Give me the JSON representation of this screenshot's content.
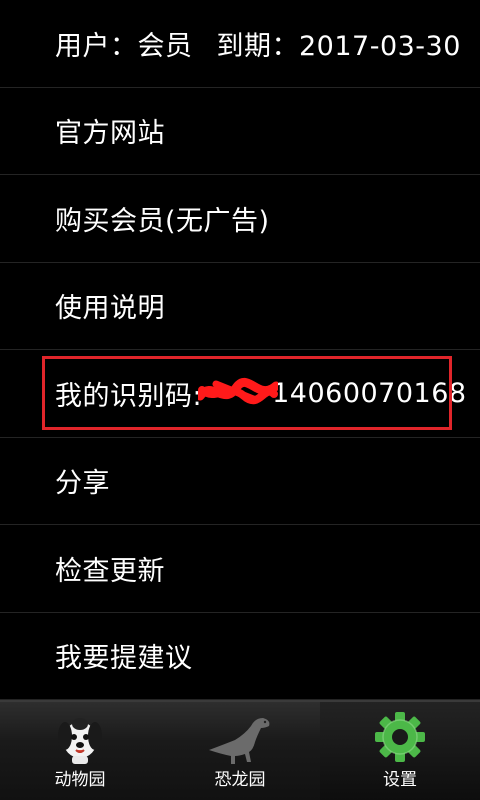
{
  "header": {
    "user_label": "用户：会员",
    "expiry_label": "到期：2017-03-30"
  },
  "menu": {
    "items": [
      {
        "label": "官方网站"
      },
      {
        "label": "购买会员(无广告)"
      },
      {
        "label": "使用说明"
      },
      {
        "label_prefix": "我的识别码:",
        "label_visible_suffix": "14060070168",
        "highlighted": true
      },
      {
        "label": "分享"
      },
      {
        "label": "检查更新"
      },
      {
        "label": "我要提建议"
      }
    ]
  },
  "tabs": [
    {
      "label": "动物园",
      "icon": "puppy-icon",
      "active": false
    },
    {
      "label": "恐龙园",
      "icon": "dinosaur-icon",
      "active": false
    },
    {
      "label": "设置",
      "icon": "gear-icon",
      "active": true
    }
  ],
  "colors": {
    "background": "#000000",
    "highlight_border": "#e0252a",
    "gear": "#4cb848",
    "redaction": "#ff1a1a"
  }
}
